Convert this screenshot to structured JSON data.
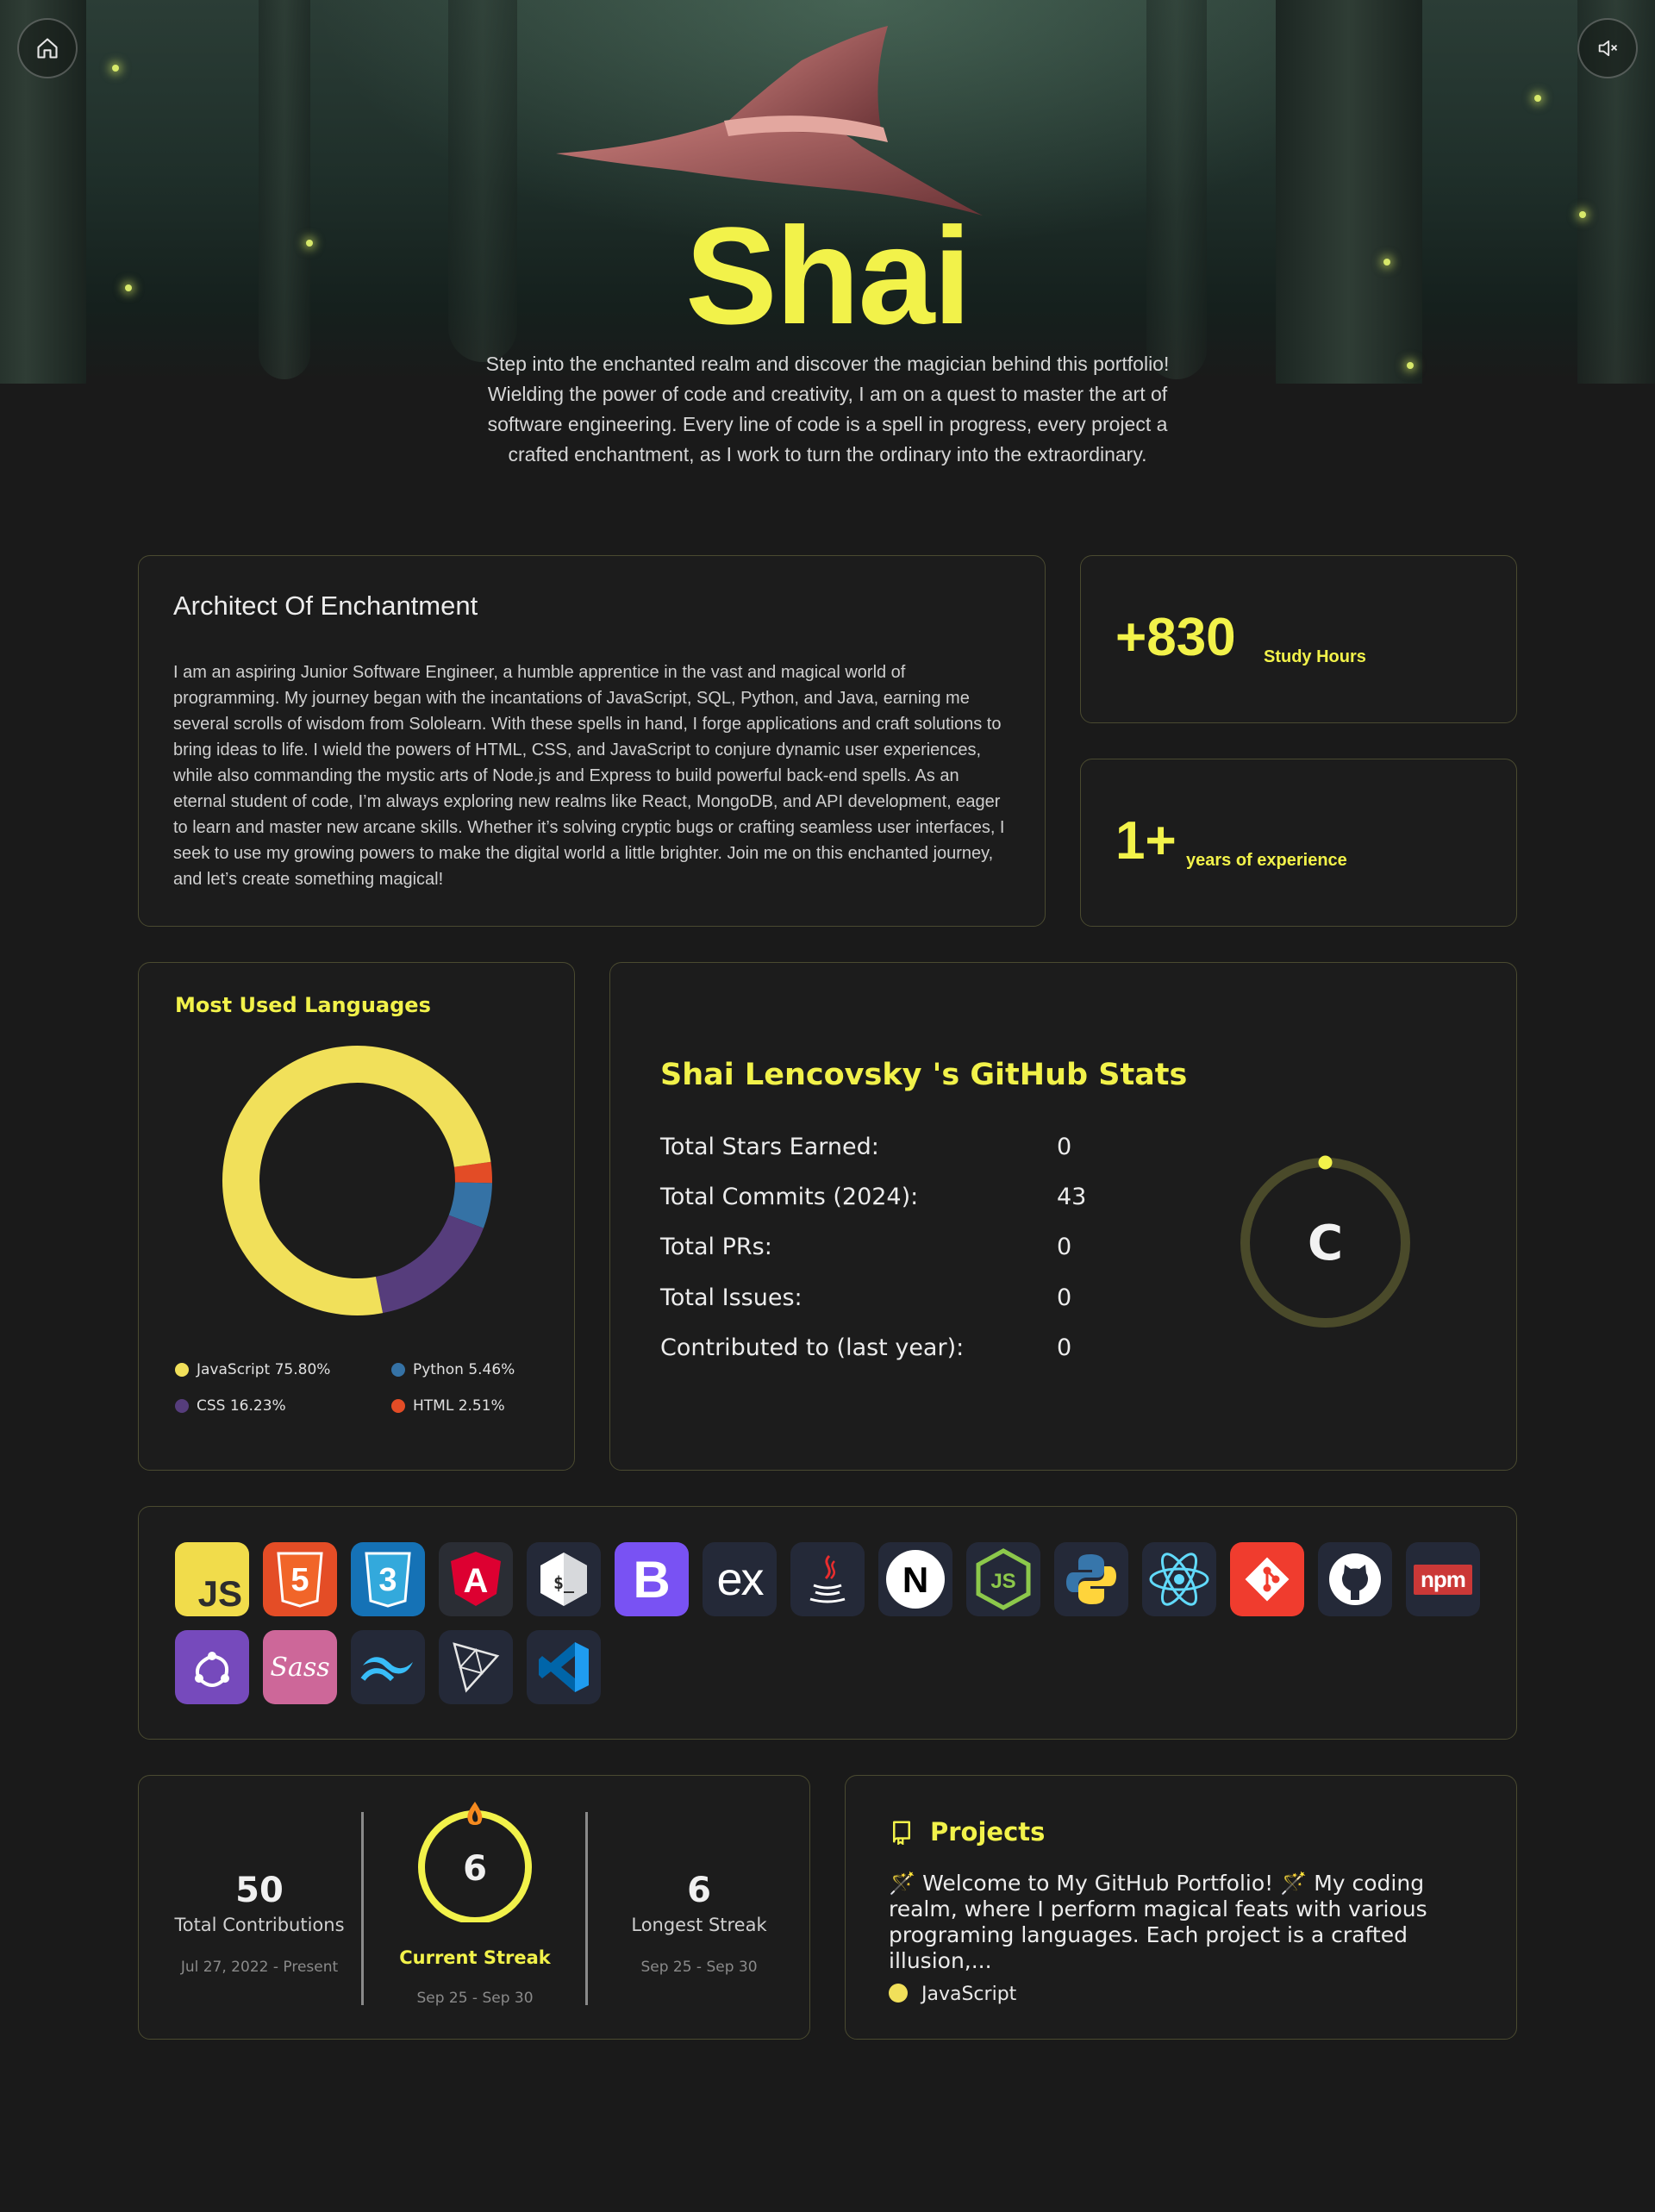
{
  "hero": {
    "title": "Shai",
    "intro": "Step into the enchanted realm and discover the magician behind this portfolio! Wielding the power of code and creativity, I am on a quest to master the art of software engineering. Every line of code is a spell in progress, every project a crafted enchantment, as I work to turn the ordinary into the extraordinary.",
    "home_icon": "home-icon",
    "mute_icon": "speaker-muted-icon"
  },
  "about": {
    "title": "Architect Of Enchantment",
    "text": "I am an aspiring Junior Software Engineer, a humble apprentice in the vast and magical world of programming. My journey began with the incantations of JavaScript, SQL, Python, and Java, earning me several scrolls of wisdom from Sololearn. With these spells in hand, I forge applications and craft solutions to bring ideas to life. I wield the powers of HTML, CSS, and JavaScript to conjure dynamic user experiences, while also commanding the mystic arts of Node.js and Express to build powerful back-end spells. As an eternal student of code, I’m always exploring new realms like React, MongoDB, and API development, eager to learn and master new arcane skills. Whether it’s solving cryptic bugs or crafting seamless user interfaces, I seek to use my growing powers to make the digital world a little brighter. Join me on this enchanted journey, and let’s create something magical!"
  },
  "stats": {
    "study_value": "+830",
    "study_label": "Study Hours",
    "exp_value": "1+",
    "exp_label": "years of experience"
  },
  "languages": {
    "title": "Most Used Languages",
    "legend": [
      {
        "name": "JavaScript",
        "pct": "75.80%",
        "label": "JavaScript 75.80%",
        "color": "#f1e05a"
      },
      {
        "name": "Python",
        "pct": "5.46%",
        "label": "Python 5.46%",
        "color": "#3572a5"
      },
      {
        "name": "CSS",
        "pct": "16.23%",
        "label": "CSS 16.23%",
        "color": "#563d7c"
      },
      {
        "name": "HTML",
        "pct": "2.51%",
        "label": "HTML 2.51%",
        "color": "#e34c26"
      }
    ]
  },
  "github": {
    "title": "Shai Lencovsky 's GitHub Stats",
    "rows": [
      {
        "label": "Total Stars Earned:",
        "value": "0"
      },
      {
        "label": "Total Commits (2024):",
        "value": "43"
      },
      {
        "label": "Total PRs:",
        "value": "0"
      },
      {
        "label": "Total Issues:",
        "value": "0"
      },
      {
        "label": "Contributed to (last year):",
        "value": "0"
      }
    ],
    "rank": "C"
  },
  "skills": [
    {
      "name": "javascript-icon",
      "text": "JS"
    },
    {
      "name": "html5-icon",
      "text": "5"
    },
    {
      "name": "css3-icon",
      "text": "3"
    },
    {
      "name": "angular-icon",
      "text": "A"
    },
    {
      "name": "bash-icon",
      "text": "$_"
    },
    {
      "name": "bootstrap-icon",
      "text": "B"
    },
    {
      "name": "express-icon",
      "text": "ex"
    },
    {
      "name": "java-icon",
      "text": ""
    },
    {
      "name": "nextjs-icon",
      "text": "N"
    },
    {
      "name": "nodejs-icon",
      "text": "JS"
    },
    {
      "name": "python-icon",
      "text": ""
    },
    {
      "name": "react-icon",
      "text": ""
    },
    {
      "name": "git-icon",
      "text": ""
    },
    {
      "name": "github-icon",
      "text": ""
    },
    {
      "name": "npm-icon",
      "text": "npm"
    },
    {
      "name": "redux-icon",
      "text": ""
    },
    {
      "name": "sass-icon",
      "text": "Sass"
    },
    {
      "name": "tailwind-icon",
      "text": ""
    },
    {
      "name": "threejs-icon",
      "text": ""
    },
    {
      "name": "vscode-icon",
      "text": ""
    }
  ],
  "streak": {
    "total_value": "50",
    "total_label": "Total Contributions",
    "total_range": "Jul 27, 2022 - Present",
    "current_value": "6",
    "current_label": "Current Streak",
    "current_range": "Sep 25 - Sep 30",
    "longest_value": "6",
    "longest_label": "Longest Streak",
    "longest_range": "Sep 25 - Sep 30"
  },
  "project": {
    "title": "Projects",
    "description": "🪄 Welcome to My GitHub Portfolio! 🪄 My coding realm, where I perform magical feats with various programing languages. Each project is a crafted illusion,...",
    "language": "JavaScript",
    "language_color": "#f1e05a"
  },
  "colors": {
    "accent": "#f2f24a",
    "background": "#1a1a1a",
    "card_border": "#4a4a30"
  }
}
